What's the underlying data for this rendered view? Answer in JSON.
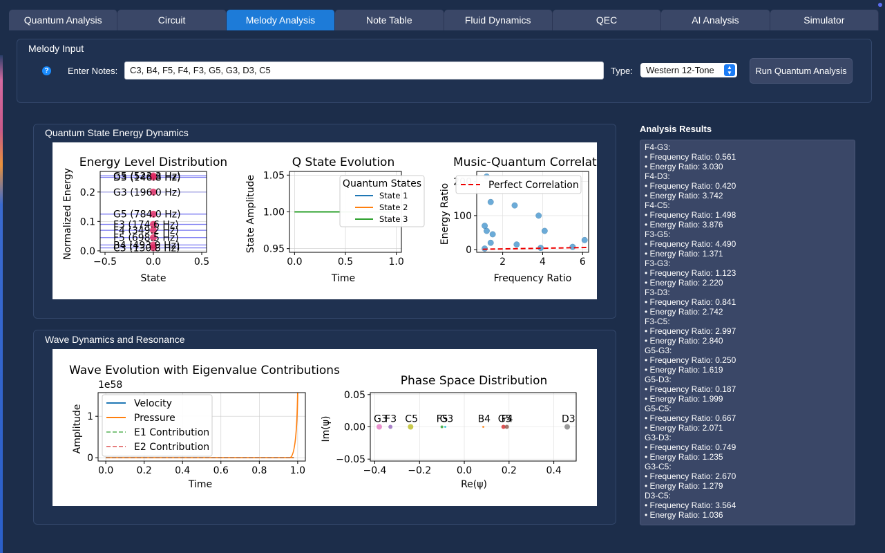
{
  "tabs": [
    "Quantum Analysis",
    "Circuit",
    "Melody Analysis",
    "Note Table",
    "Fluid Dynamics",
    "QEC",
    "AI Analysis",
    "Simulator"
  ],
  "active_tab": "Melody Analysis",
  "melody_input": {
    "title": "Melody Input",
    "help_glyph": "?",
    "notes_label": "Enter Notes:",
    "notes_value": "C3, B4, F5, F4, F3, G5, G3, D3, C5",
    "type_label": "Type:",
    "type_value": "Western 12-Tone",
    "run_button": "Run Quantum Analysis"
  },
  "energy_panel": {
    "title": "Quantum State Energy Dynamics",
    "energy_chart": {
      "title": "Energy Level Distribution",
      "xlabel": "State",
      "ylabel": "Normalized Energy",
      "xticks": [
        "−0.5",
        "0.0",
        "0.5"
      ],
      "yticks": [
        "0.0",
        "0.1",
        "0.2"
      ],
      "levels": [
        {
          "label": "G5 (523.3 Hz)",
          "y": 0.255
        },
        {
          "label": "D3 (146.8 Hz)",
          "y": 0.25
        },
        {
          "label": "G3 (196.0 Hz)",
          "y": 0.2
        },
        {
          "label": "G5 (784.0 Hz)",
          "y": 0.125
        },
        {
          "label": "F3 (174.6 Hz)",
          "y": 0.09
        },
        {
          "label": "F4 (349.2 Hz)",
          "y": 0.07
        },
        {
          "label": "F5 (698.5 Hz)",
          "y": 0.045
        },
        {
          "label": "B4 (493.9 Hz)",
          "y": 0.02
        },
        {
          "label": "C3 (130.8 Hz)",
          "y": 0.01
        }
      ]
    },
    "state_chart": {
      "title": "Q State Evolution",
      "xlabel": "Time",
      "ylabel": "State Amplitude",
      "xticks": [
        "0.0",
        "0.5",
        "1.0"
      ],
      "yticks": [
        "0.95",
        "1.00",
        "1.05"
      ],
      "legend_title": "Quantum States",
      "legend": [
        "State 1",
        "State 2",
        "State 3"
      ],
      "colors": [
        "#1f77b4",
        "#ff7f0e",
        "#2ca02c"
      ]
    },
    "corr_chart": {
      "title": "Music-Quantum Correlati",
      "xlabel": "Frequency Ratio",
      "ylabel": "Energy Ratio",
      "xticks": [
        "2",
        "4",
        "6"
      ],
      "yticks": [
        "0",
        "100",
        "200"
      ],
      "legend": "Perfect Correlation",
      "points": [
        [
          1.2,
          215
        ],
        [
          1.4,
          140
        ],
        [
          1.1,
          70
        ],
        [
          1.2,
          55
        ],
        [
          1.5,
          45
        ],
        [
          1.4,
          20
        ],
        [
          1.1,
          3
        ],
        [
          2.6,
          130
        ],
        [
          2.7,
          15
        ],
        [
          3.8,
          100
        ],
        [
          4.1,
          55
        ],
        [
          3.9,
          5
        ],
        [
          5.5,
          8
        ],
        [
          6.1,
          28
        ]
      ]
    }
  },
  "wave_panel": {
    "title": "Wave Dynamics and Resonance",
    "wave_chart": {
      "title": "Wave Evolution with Eigenvalue Contributions",
      "xlabel": "Time",
      "ylabel": "Amplitude",
      "offset": "1e58",
      "xticks": [
        "0.0",
        "0.2",
        "0.4",
        "0.6",
        "0.8",
        "1.0"
      ],
      "yticks": [
        "0",
        "1"
      ],
      "legend": [
        "Velocity",
        "Pressure",
        "E1 Contribution",
        "E2 Contribution"
      ]
    },
    "phase_chart": {
      "title": "Phase Space Distribution",
      "xlabel": "Re(ψ)",
      "ylabel": "Im(ψ)",
      "xticks": [
        "−0.4",
        "−0.2",
        "0.0",
        "0.2",
        "0.4"
      ],
      "yticks": [
        "−0.05",
        "0.00",
        "0.05"
      ],
      "points": [
        {
          "label": "G3",
          "x": -0.38,
          "color": "#e377c2",
          "r": 4
        },
        {
          "label": "F3",
          "x": -0.33,
          "color": "#9467bd",
          "r": 3
        },
        {
          "label": "C5",
          "x": -0.24,
          "color": "#bcbd22",
          "r": 4
        },
        {
          "label": "F5",
          "x": -0.1,
          "color": "#2ca02c",
          "r": 2
        },
        {
          "label": "G3",
          "x": -0.085,
          "color": "#17becf",
          "r": 1.5
        },
        {
          "label": "B4",
          "x": 0.085,
          "color": "#ff7f0e",
          "r": 1.5
        },
        {
          "label": "G5",
          "x": 0.175,
          "color": "#d62728",
          "r": 3
        },
        {
          "label": "F4",
          "x": 0.19,
          "color": "#8c564b",
          "r": 3
        },
        {
          "label": "D3",
          "x": 0.46,
          "color": "#7f7f7f",
          "r": 4
        }
      ]
    }
  },
  "results": {
    "title": "Analysis Results",
    "lines": [
      "F4-G3:",
      "• Frequency Ratio: 0.561",
      "• Energy Ratio: 3.030",
      "F4-D3:",
      "• Frequency Ratio: 0.420",
      "• Energy Ratio: 3.742",
      "F4-C5:",
      "• Frequency Ratio: 1.498",
      "• Energy Ratio: 3.876",
      "F3-G5:",
      "• Frequency Ratio: 4.490",
      "• Energy Ratio: 1.371",
      "F3-G3:",
      "• Frequency Ratio: 1.123",
      "• Energy Ratio: 2.220",
      "F3-D3:",
      "• Frequency Ratio: 0.841",
      "• Energy Ratio: 2.742",
      "F3-C5:",
      "• Frequency Ratio: 2.997",
      "• Energy Ratio: 2.840",
      "G5-G3:",
      "• Frequency Ratio: 0.250",
      "• Energy Ratio: 1.619",
      "G5-D3:",
      "• Frequency Ratio: 0.187",
      "• Energy Ratio: 1.999",
      "G5-C5:",
      "• Frequency Ratio: 0.667",
      "• Energy Ratio: 2.071",
      "G3-D3:",
      "• Frequency Ratio: 0.749",
      "• Energy Ratio: 1.235",
      "G3-C5:",
      "• Frequency Ratio: 2.670",
      "• Energy Ratio: 1.279",
      "D3-C5:",
      "• Frequency Ratio: 3.564",
      "• Energy Ratio: 1.036"
    ]
  }
}
